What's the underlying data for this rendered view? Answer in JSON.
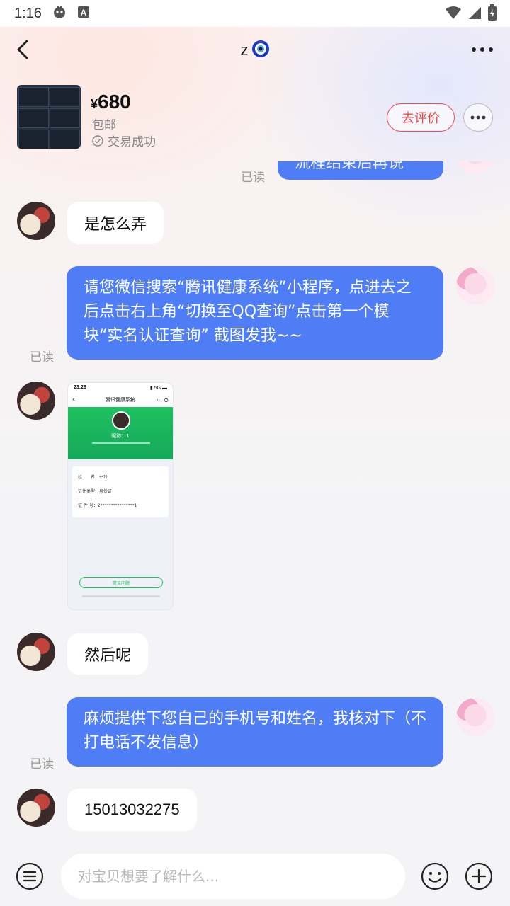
{
  "status_bar": {
    "time": "1:16"
  },
  "header": {
    "title": "z",
    "icons": [
      "back-icon",
      "evil-eye-icon",
      "more-icon"
    ]
  },
  "product": {
    "currency": "¥",
    "price": "680",
    "shipping": "包邮",
    "status": "交易成功",
    "review_button": "去评价"
  },
  "chat": {
    "partial_top_text": "流程结束后再说",
    "messages": [
      {
        "side": "left",
        "text": "是怎么弄"
      },
      {
        "side": "right",
        "text": "请您微信搜索“腾讯健康系统”小程序，点进去之后点击右上角“切换至QQ查询”点击第一个模块“实名认证查询” 截图发我~~",
        "read": "已读"
      },
      {
        "side": "left",
        "type": "image"
      },
      {
        "side": "left",
        "text": "然后呢"
      },
      {
        "side": "right",
        "text": "麻烦提供下您自己的手机号和姓名，我核对下（不打电话不发信息）",
        "read": "已读"
      },
      {
        "side": "left",
        "text": "15013032275"
      }
    ],
    "top_read": "已读"
  },
  "screenshot_image": {
    "time": "23:29",
    "title": "腾讯健康系统",
    "nickname_label": "昵称：",
    "nickname_value": "1",
    "fields": [
      {
        "label": "姓　　名：",
        "value": "**玲"
      },
      {
        "label": "证件类型：",
        "value": "身份证"
      },
      {
        "label": "证 件 号：",
        "value": "2****************1"
      }
    ],
    "faq_button": "常见问题"
  },
  "input_bar": {
    "placeholder": "对宝贝想要了解什么..."
  },
  "colors": {
    "bubble_me": "#4f7df6",
    "bubble_other": "#ffffff",
    "review_red": "#e8504a",
    "green": "#1db954"
  }
}
